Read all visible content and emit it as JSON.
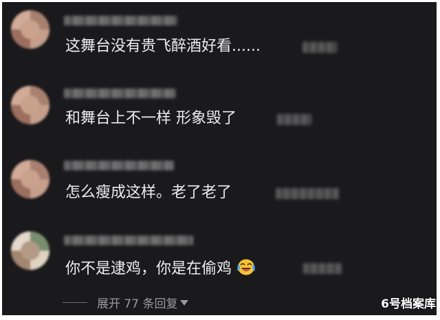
{
  "comments": [
    {
      "text": "这舞台没有贵飞醉酒好看......"
    },
    {
      "text": "和舞台上不一样 形象毁了"
    },
    {
      "text": "怎么瘦成这样。老了老了"
    },
    {
      "text": "你不是逮鸡，你是在偷鸡",
      "emoji": "laughing-tears-emoji"
    }
  ],
  "replies": {
    "expand_label": "展开 77 条回复"
  },
  "watermark": "6号档案库",
  "colors": {
    "background": "#1a191c",
    "text": "#ededed",
    "muted": "#9b9b9b"
  }
}
